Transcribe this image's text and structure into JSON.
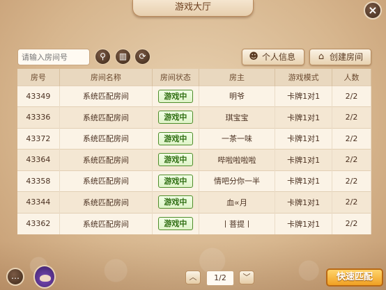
{
  "title": "游戏大厅",
  "close_icon": "×",
  "search": {
    "placeholder": "请输入房间号"
  },
  "toolbar": {
    "search_icon": "⚲",
    "stats_icon": "▥",
    "refresh_icon": "⟳",
    "profile_label": "个人信息",
    "create_label": "创建房间"
  },
  "table": {
    "headers": [
      "房号",
      "房间名称",
      "房间状态",
      "房主",
      "游戏模式",
      "人数"
    ],
    "rows": [
      [
        "43349",
        "系统匹配房间",
        "游戏中",
        "明爷",
        "卡牌1对1",
        "2/2"
      ],
      [
        "43336",
        "系统匹配房间",
        "游戏中",
        "琪宝宝",
        "卡牌1对1",
        "2/2"
      ],
      [
        "43372",
        "系统匹配房间",
        "游戏中",
        "一茶一味",
        "卡牌1对1",
        "2/2"
      ],
      [
        "43364",
        "系统匹配房间",
        "游戏中",
        "哔啦啦啦啦",
        "卡牌1对1",
        "2/2"
      ],
      [
        "43358",
        "系统匹配房间",
        "游戏中",
        "情吧分你一半",
        "卡牌1对1",
        "2/2"
      ],
      [
        "43344",
        "系统匹配房间",
        "游戏中",
        "血∝月",
        "卡牌1对1",
        "2/2"
      ],
      [
        "43362",
        "系统匹配房间",
        "游戏中",
        "丨菩提丨",
        "卡牌1对1",
        "2/2"
      ]
    ]
  },
  "pagination": {
    "prev_icon": "︿",
    "next_icon": "﹀",
    "page": "1/2"
  },
  "chat_icon": "…",
  "quick_match_label": "快速匹配"
}
